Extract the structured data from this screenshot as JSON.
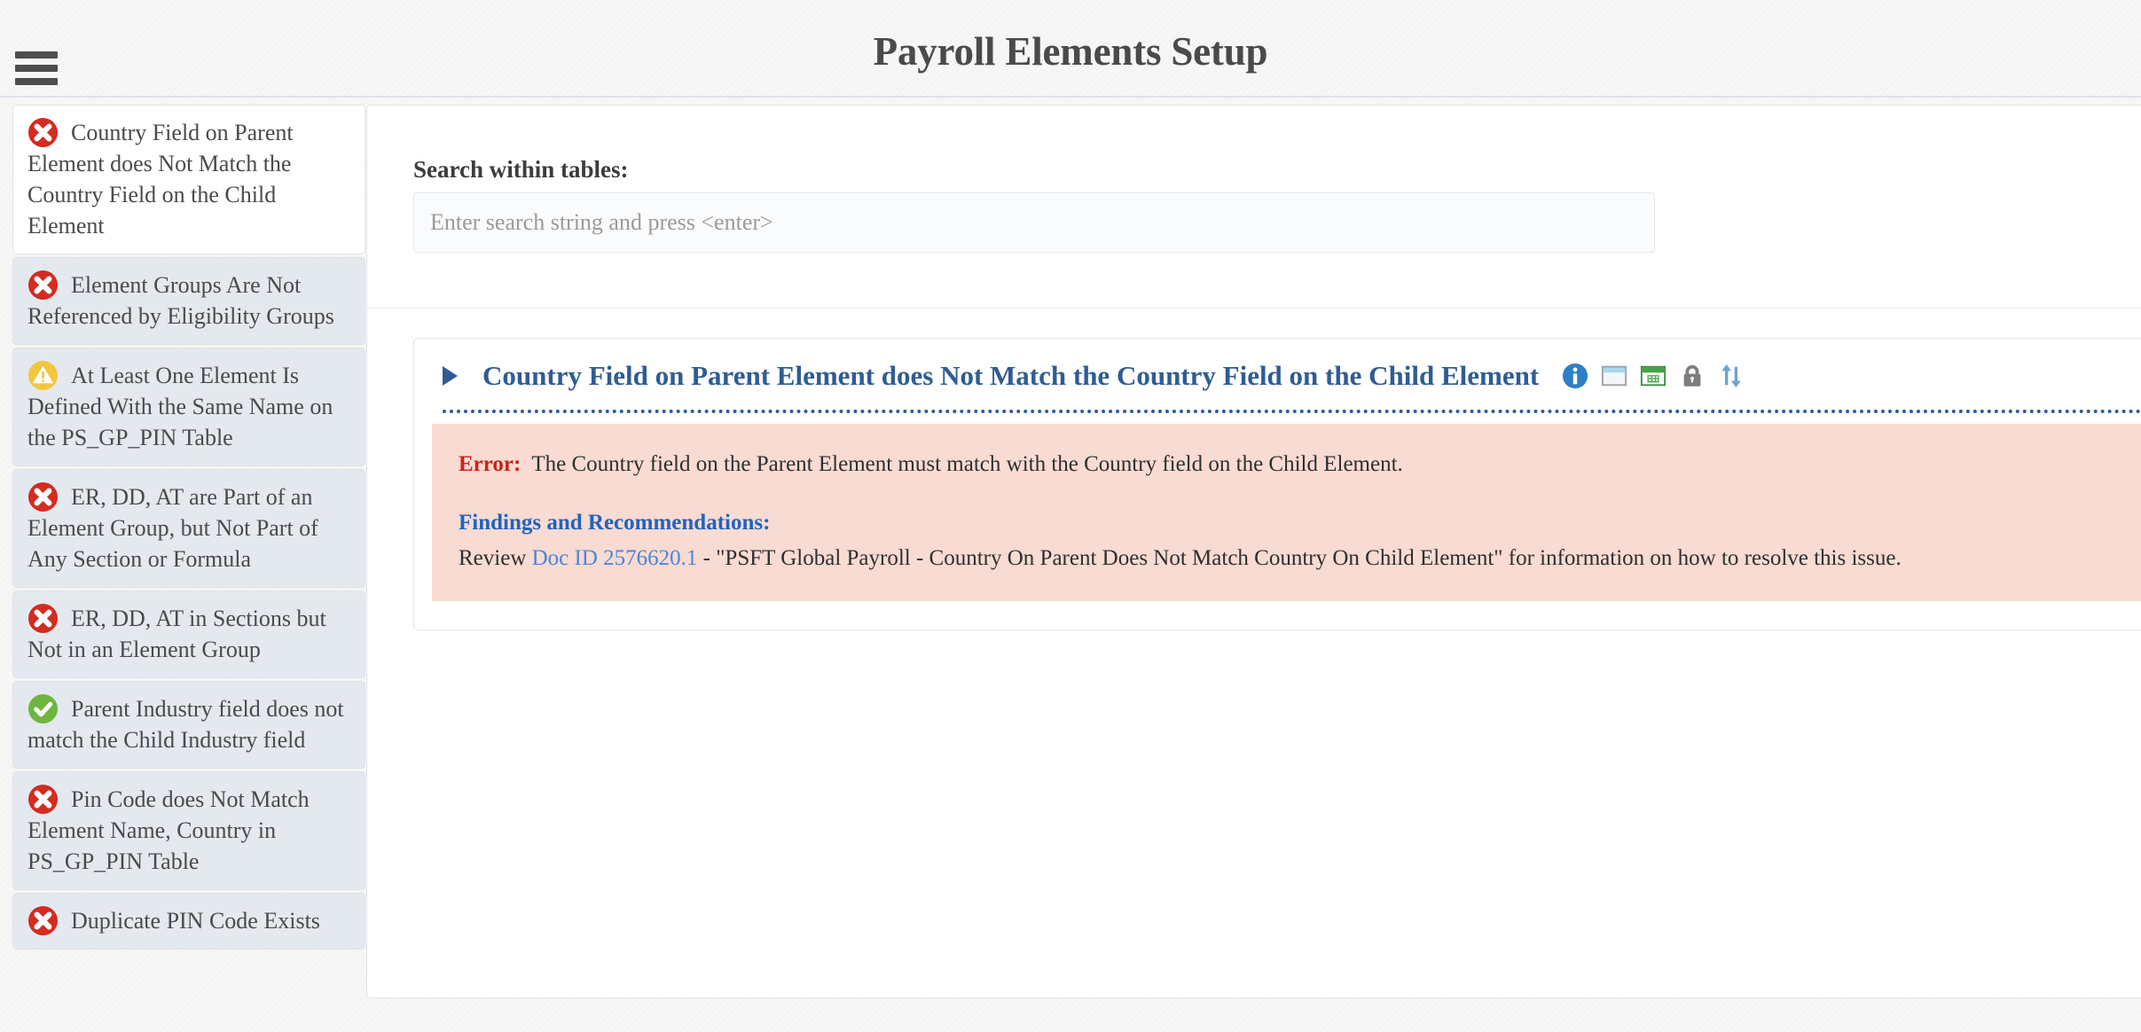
{
  "header": {
    "title": "Payroll Elements Setup",
    "menu_icon": "hamburger-icon"
  },
  "sidebar": {
    "items": [
      {
        "status": "error",
        "label": "Country Field on Parent Element does Not Match the Country Field on the Child Element",
        "active": true
      },
      {
        "status": "error",
        "label": "Element Groups Are Not Referenced by Eligibility Groups",
        "active": false
      },
      {
        "status": "warning",
        "label": "At Least One Element Is Defined With the Same Name on the PS_GP_PIN Table",
        "active": false
      },
      {
        "status": "error",
        "label": "ER, DD, AT are Part of an Element Group, but Not Part of Any Section or Formula",
        "active": false
      },
      {
        "status": "error",
        "label": "ER, DD, AT in Sections but Not in an Element Group",
        "active": false
      },
      {
        "status": "success",
        "label": "Parent Industry field does not match the Child Industry field",
        "active": false
      },
      {
        "status": "error",
        "label": "Pin Code does Not Match Element Name, Country in PS_GP_PIN Table",
        "active": false
      },
      {
        "status": "error",
        "label": "Duplicate PIN Code Exists",
        "active": false
      }
    ]
  },
  "main": {
    "search": {
      "label": "Search within tables:",
      "placeholder": "Enter search string and press <enter>",
      "value": ""
    },
    "finding": {
      "toggle_icon": "triangle-right-icon",
      "title": "Country Field on Parent Element does Not Match the Country Field on the Child Element",
      "action_icons": [
        "info-icon",
        "table-view-icon",
        "export-excel-icon",
        "lock-icon",
        "sort-updown-icon"
      ],
      "error_keyword": "Error:",
      "error_text": "The Country field on the Parent Element must match with the Country field on the Child Element.",
      "findings_keyword": "Findings and Recommendations:",
      "recommendation_prefix": "Review ",
      "doc_link": "Doc ID 2576620.1",
      "recommendation_suffix": " - \"PSFT Global Payroll - Country On Parent Does Not Match Country On Child Element\" for information on how to resolve this issue."
    }
  },
  "colors": {
    "accent_blue": "#2f5c94",
    "link_blue": "#4d85d6",
    "error_red": "#c9231a",
    "error_bg": "#f8dbd2",
    "warning_yellow": "#f0c040",
    "success_green": "#6db33f"
  }
}
